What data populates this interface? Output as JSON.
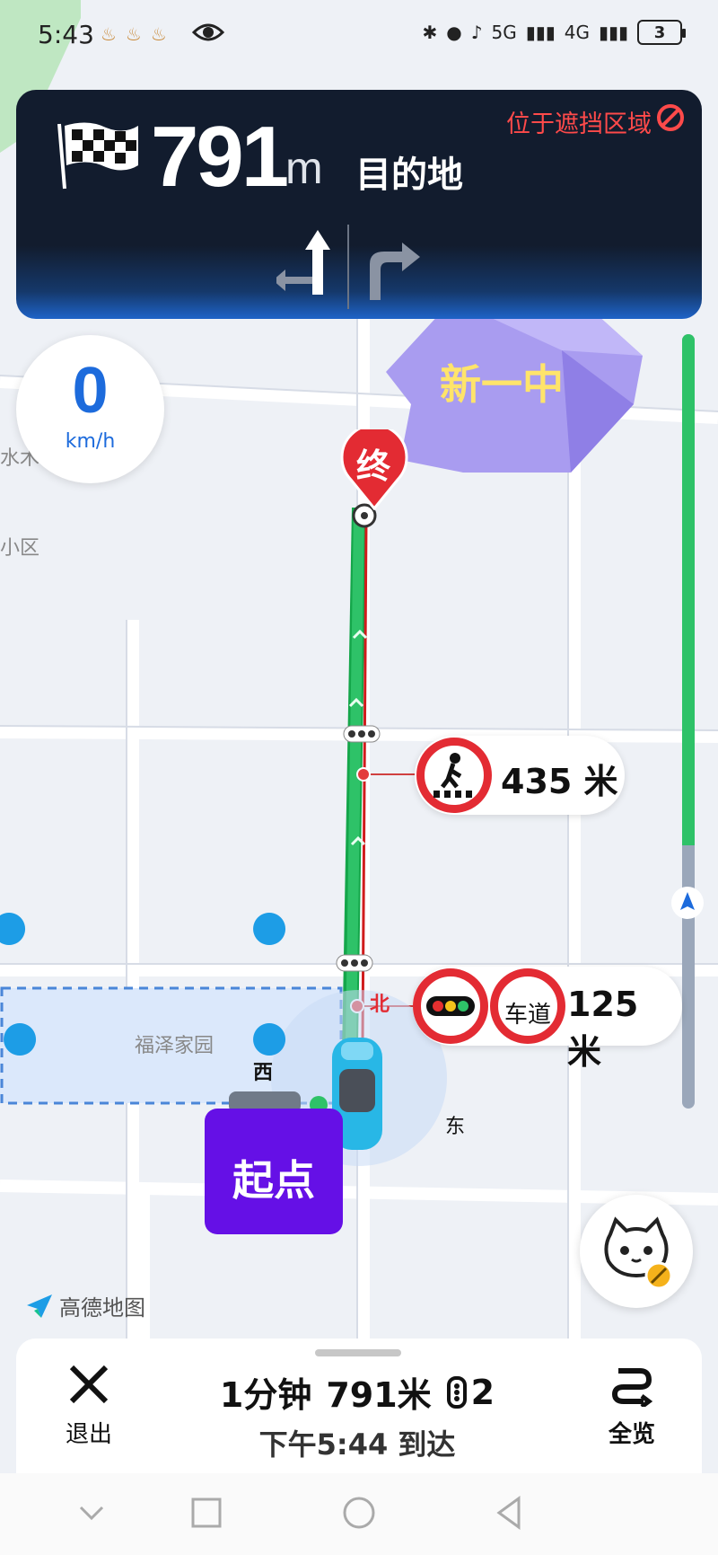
{
  "status_bar": {
    "time": "5:43",
    "notifications": "♨♨♨",
    "network_5g": "5G",
    "network_4g": "4G",
    "battery": "3"
  },
  "nav_banner": {
    "distance": "791",
    "unit": "m",
    "destination_label": "目的地",
    "occlusion_warning": "位于遮挡区域"
  },
  "speed": {
    "value": "0",
    "unit": "km/h"
  },
  "destination": {
    "name": "新一中",
    "end_marker": "终"
  },
  "alerts": [
    {
      "sign": "pedestrian-crossing",
      "distance": "435 米"
    },
    {
      "sign": "traffic-light",
      "lane_text": "车道",
      "distance": "125 米"
    }
  ],
  "map_labels": {
    "poi_left_1": "水木",
    "poi_left_2": "小区",
    "community": "福泽家园",
    "west": "西",
    "east": "东",
    "north": "北"
  },
  "start": {
    "label": "起点"
  },
  "logo": {
    "text": "高德地图"
  },
  "route_progress": {
    "completed_fraction": 0.66
  },
  "bottom_panel": {
    "exit_label": "退出",
    "duration": "1分钟",
    "distance": "791米",
    "traffic_lights": "2",
    "arrival": "下午5:44 到达",
    "overview_label": "全览"
  },
  "colors": {
    "route_green": "#2ec268",
    "banner_dark": "#121c2e",
    "accent_red": "#e32b33",
    "start_purple": "#6510e6",
    "speed_blue": "#1d6bdc"
  }
}
